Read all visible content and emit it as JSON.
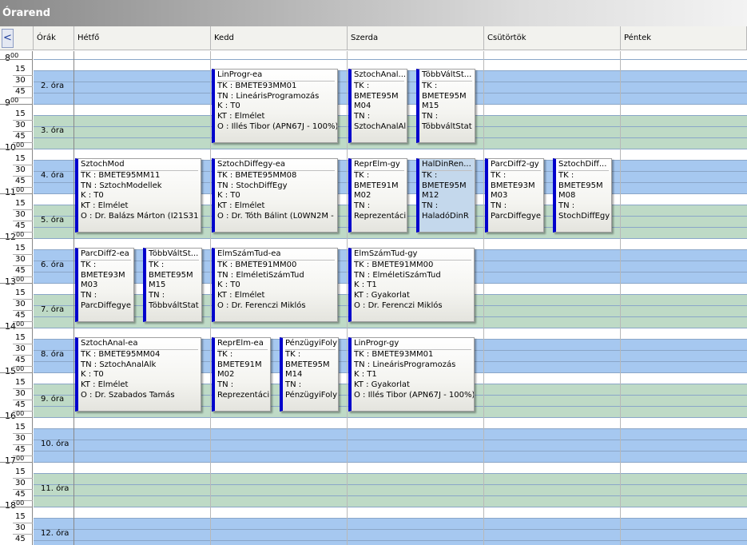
{
  "window": {
    "title": "Órarend"
  },
  "header": {
    "nav_label": "<",
    "columns": [
      "Órák",
      "Hétfő",
      "Kedd",
      "Szerda",
      "Csütörtök",
      "Péntek"
    ]
  },
  "times": [
    {
      "hour": "8",
      "sup": "00",
      "mins": [
        "15",
        "30",
        "45"
      ]
    },
    {
      "hour": "9",
      "sup": "00",
      "mins": [
        "15",
        "30",
        "45"
      ]
    },
    {
      "hour": "10",
      "sup": "00",
      "mins": [
        "15",
        "30",
        "45"
      ]
    },
    {
      "hour": "11",
      "sup": "00",
      "mins": [
        "15",
        "30",
        "45"
      ]
    },
    {
      "hour": "12",
      "sup": "00",
      "mins": [
        "15",
        "30",
        "45"
      ]
    },
    {
      "hour": "13",
      "sup": "00",
      "mins": [
        "15",
        "30",
        "45"
      ]
    },
    {
      "hour": "14",
      "sup": "00",
      "mins": [
        "15",
        "30",
        "45"
      ]
    },
    {
      "hour": "15",
      "sup": "00",
      "mins": [
        "15",
        "30",
        "45"
      ]
    },
    {
      "hour": "16",
      "sup": "00",
      "mins": [
        "15",
        "30",
        "45"
      ]
    },
    {
      "hour": "17",
      "sup": "00",
      "mins": [
        "15",
        "30",
        "45"
      ]
    },
    {
      "hour": "18",
      "sup": "00",
      "mins": [
        "15",
        "30",
        "45"
      ]
    }
  ],
  "periods": [
    "2. óra",
    "3. óra",
    "4. óra",
    "5. óra",
    "6. óra",
    "7. óra",
    "8. óra",
    "9. óra",
    "10. óra",
    "11. óra",
    "12. óra"
  ],
  "colors": {
    "period_a": "#a6c8f0",
    "period_b": "#bedac6",
    "card_bar": "#0000cc",
    "selected": "#c4d8ec"
  },
  "events": [
    {
      "lines": [
        "LinProgr-ea",
        "TK : BMETE93MM01",
        "TN : LineárisProgramozás",
        "K : T0",
        "KT : Elmélet",
        "O : Illés Tibor (APN67J - 100%)"
      ]
    },
    {
      "lines": [
        "SztochAnal...",
        "TK :",
        "BMETE95M",
        "M04",
        "TN :",
        "SztochAnalAl"
      ]
    },
    {
      "lines": [
        "TöbbVáltSt...",
        "TK :",
        "BMETE95M",
        "M15",
        "TN :",
        "TöbbváltStat"
      ]
    },
    {
      "lines": [
        "SztochMod",
        "TK : BMETE95MM11",
        "TN : SztochModellek",
        "K : T0",
        "KT : Elmélet",
        "O : Dr. Balázs Márton (I21S31"
      ]
    },
    {
      "lines": [
        "SztochDiffegy-ea",
        "TK : BMETE95MM08",
        "TN : StochDiffEgy",
        "K : T0",
        "KT : Elmélet",
        "O : Dr. Tóth Bálint (L0WN2M -"
      ]
    },
    {
      "lines": [
        "ReprElm-gy",
        "TK :",
        "BMETE91M",
        "M02",
        "TN :",
        "Reprezentáci"
      ]
    },
    {
      "lines": [
        "HalDinRen...",
        "TK :",
        "BMETE95M",
        "M12",
        "TN :",
        "HaladóDinR"
      ],
      "selected": true
    },
    {
      "lines": [
        "ParcDiff2-gy",
        "TK :",
        "BMETE93M",
        "M03",
        "TN :",
        "ParcDiffegye"
      ]
    },
    {
      "lines": [
        "SztochDiff...",
        "TK :",
        "BMETE95M",
        "M08",
        "TN :",
        "StochDiffEgy"
      ]
    },
    {
      "lines": [
        "ParcDiff2-ea",
        "TK :",
        "BMETE93M",
        "M03",
        "TN :",
        "ParcDiffegye"
      ]
    },
    {
      "lines": [
        "TöbbVáltSt...",
        "TK :",
        "BMETE95M",
        "M15",
        "TN :",
        "TöbbváltStat"
      ]
    },
    {
      "lines": [
        "ElmSzámTud-ea",
        "TK : BMETE91MM00",
        "TN : ElméletiSzámTud",
        "K : T0",
        "KT : Elmélet",
        "O : Dr. Ferenczi Miklós"
      ]
    },
    {
      "lines": [
        "ElmSzámTud-gy",
        "TK : BMETE91MM00",
        "TN : ElméletiSzámTud",
        "K : T1",
        "KT : Gyakorlat",
        "O : Dr. Ferenczi Miklós"
      ]
    },
    {
      "lines": [
        "SztochAnal-ea",
        "TK : BMETE95MM04",
        "TN : SztochAnalAlk",
        "K : T0",
        "KT : Elmélet",
        "O : Dr. Szabados Tamás"
      ]
    },
    {
      "lines": [
        "ReprElm-ea",
        "TK :",
        "BMETE91M",
        "M02",
        "TN :",
        "Reprezentáci"
      ]
    },
    {
      "lines": [
        "PénzügyiFoly",
        "TK :",
        "BMETE95M",
        "M14",
        "TN :",
        "PénzügyiFoly"
      ]
    },
    {
      "lines": [
        "LinProgr-gy",
        "TK : BMETE93MM01",
        "TN : LineárisProgramozás",
        "K : T1",
        "KT : Gyakorlat",
        "O : Illés Tibor (APN67J - 100%)"
      ]
    }
  ]
}
